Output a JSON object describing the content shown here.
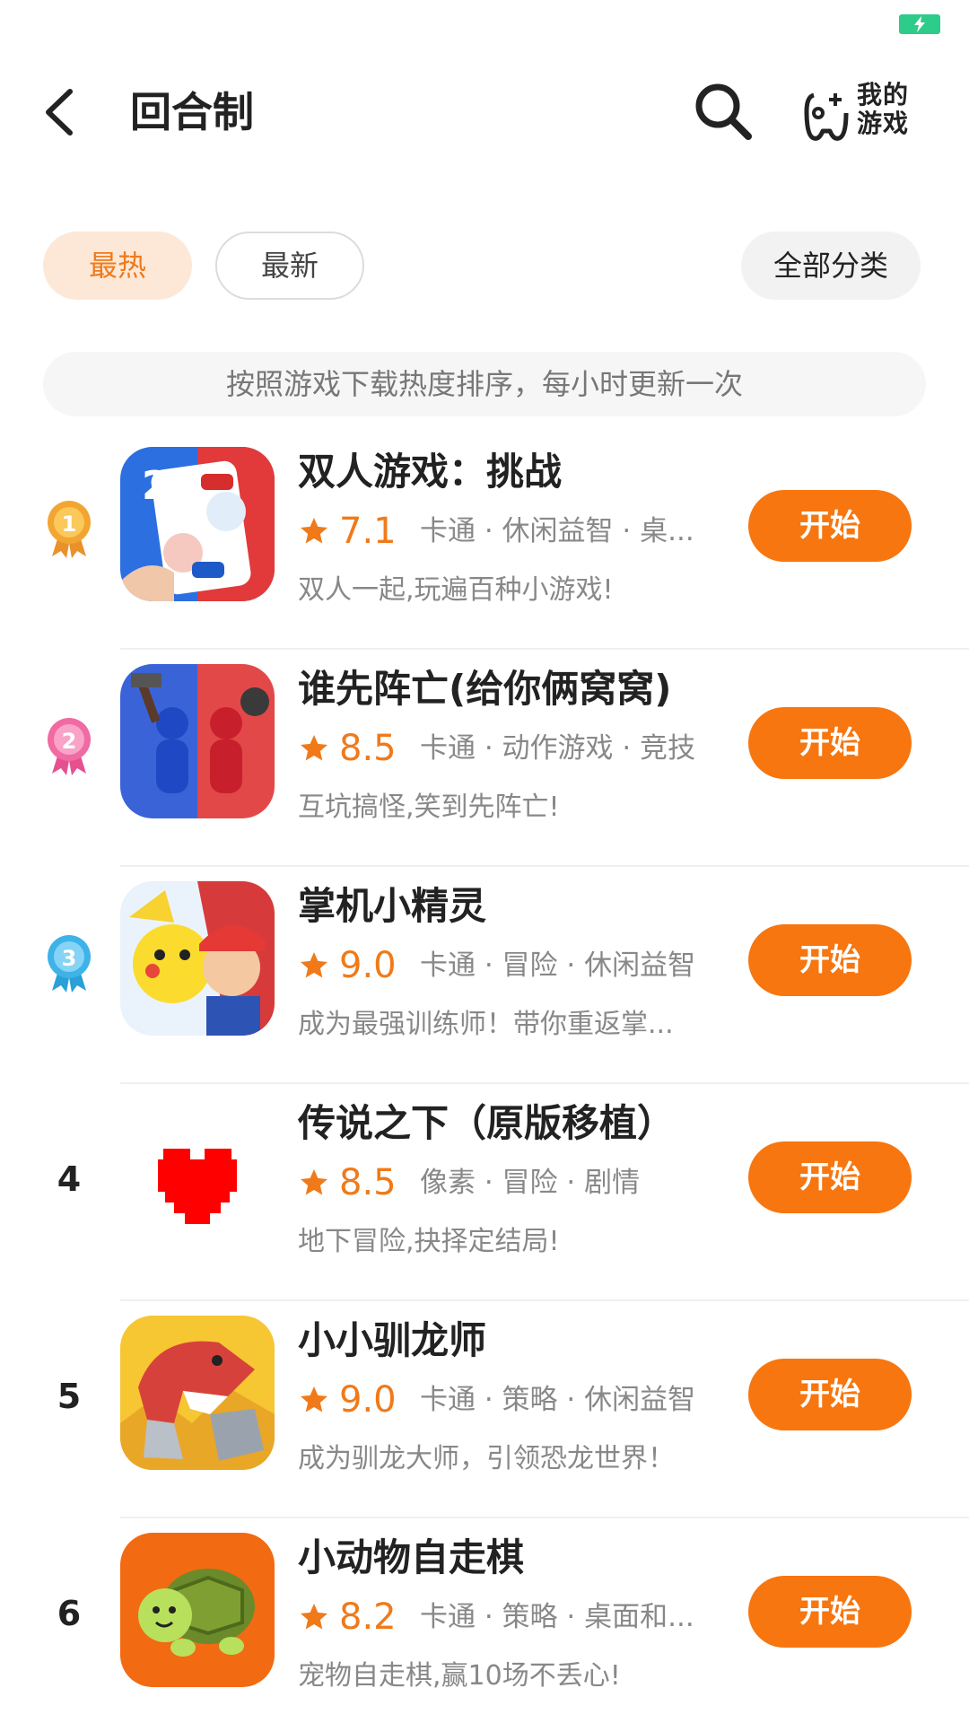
{
  "status_bar": {
    "battery_icon": "battery-charging-icon",
    "battery_color": "#2ecc8a"
  },
  "header": {
    "title": "回合制",
    "back_icon": "chevron-left-icon",
    "search_icon": "search-icon",
    "my_games_icon": "gamepad-icon",
    "my_games_label": "我的游戏"
  },
  "tabs": {
    "hot": "最热",
    "new": "最新",
    "all_categories": "全部分类",
    "active": "最热"
  },
  "notice": "按照游戏下载热度排序，每小时更新一次",
  "colors": {
    "accent": "#f7760f",
    "accent_light": "#fde8d8",
    "rating": "#f07a1a"
  },
  "games": [
    {
      "rank": "1",
      "name": "双人游戏：挑战",
      "score": "7.1",
      "tags": "卡通 · 休闲益智 · 桌...",
      "desc": "双人一起,玩遍百种小游戏!",
      "button": "开始"
    },
    {
      "rank": "2",
      "name": "谁先阵亡(给你俩窝窝)",
      "score": "8.5",
      "tags": "卡通 · 动作游戏 · 竞技",
      "desc": "互坑搞怪,笑到先阵亡!",
      "button": "开始"
    },
    {
      "rank": "3",
      "name": "掌机小精灵",
      "score": "9.0",
      "tags": "卡通 · 冒险 · 休闲益智",
      "desc": "成为最强训练师！带你重返掌...",
      "button": "开始"
    },
    {
      "rank": "4",
      "name": "传说之下（原版移植）",
      "score": "8.5",
      "tags": "像素 · 冒险 · 剧情",
      "desc": "地下冒险,抉择定结局!",
      "button": "开始"
    },
    {
      "rank": "5",
      "name": "小小驯龙师",
      "score": "9.0",
      "tags": "卡通 · 策略 · 休闲益智",
      "desc": "成为驯龙大师，引领恐龙世界！",
      "button": "开始"
    },
    {
      "rank": "6",
      "name": "小动物自走棋",
      "score": "8.2",
      "tags": "卡通 · 策略 · 桌面和...",
      "desc": "宠物自走棋,赢10场不丢心!",
      "button": "开始"
    }
  ]
}
